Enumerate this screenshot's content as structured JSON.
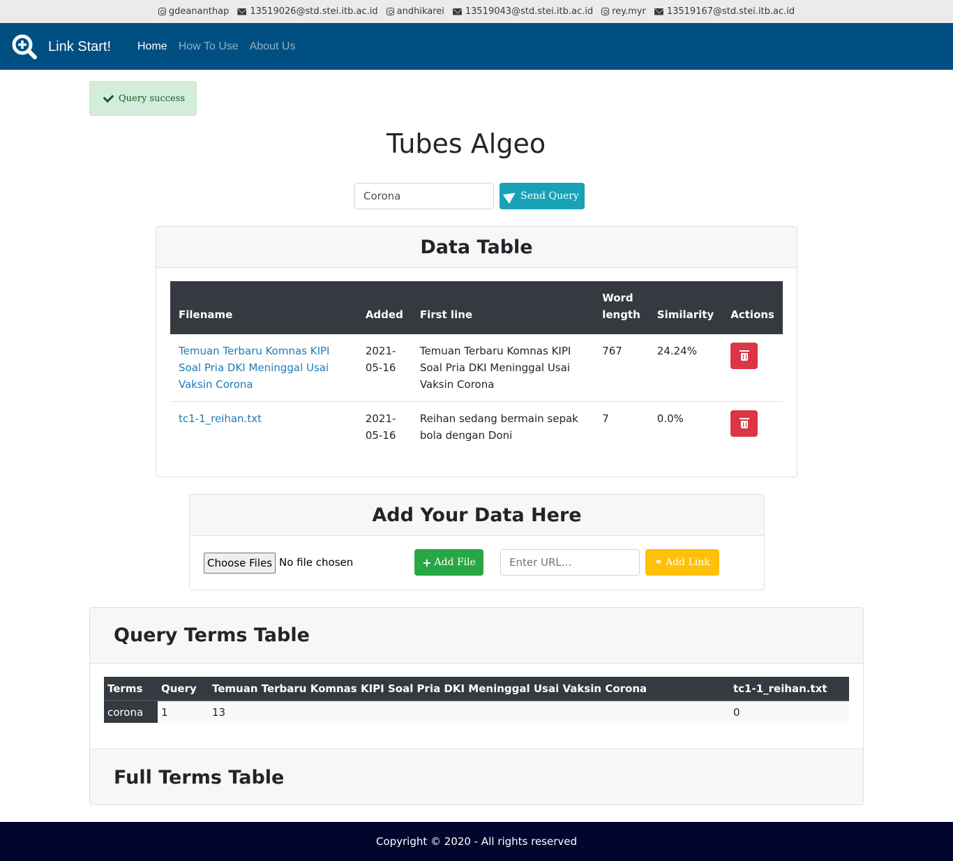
{
  "contacts": [
    {
      "type": "instagram",
      "text": "gdeananthap"
    },
    {
      "type": "email",
      "text": "13519026@std.stei.itb.ac.id"
    },
    {
      "type": "instagram",
      "text": "andhikarei"
    },
    {
      "type": "email",
      "text": "13519043@std.stei.itb.ac.id"
    },
    {
      "type": "instagram",
      "text": "rey.myr"
    },
    {
      "type": "email",
      "text": "13519167@std.stei.itb.ac.id"
    }
  ],
  "navbar": {
    "brand": "Link Start!",
    "links": [
      {
        "label": "Home",
        "active": true
      },
      {
        "label": "How To Use",
        "active": false
      },
      {
        "label": "About Us",
        "active": false
      }
    ]
  },
  "alert": {
    "text": "Query success"
  },
  "title": "Tubes Algeo",
  "search": {
    "value": "Corona",
    "button_label": "Send Query"
  },
  "data_table": {
    "title": "Data Table",
    "columns": [
      "Filename",
      "Added",
      "First line",
      "Word length",
      "Similarity",
      "Actions"
    ],
    "rows": [
      {
        "filename": "Temuan Terbaru Komnas KIPI Soal Pria DKI Meninggal Usai Vaksin Corona",
        "added": "2021-05-16",
        "first_line": "Temuan Terbaru Komnas KIPI Soal Pria DKI Meninggal Usai Vaksin Corona",
        "word_length": "767",
        "similarity": "24.24%"
      },
      {
        "filename": "tc1-1_reihan.txt",
        "added": "2021-05-16",
        "first_line": "Reihan sedang bermain sepak bola dengan Doni",
        "word_length": "7",
        "similarity": "0.0%"
      }
    ]
  },
  "add_data": {
    "title": "Add Your Data Here",
    "choose_files_label": "Choose Files",
    "no_file_text": "No file chosen",
    "add_file_label": "Add File",
    "url_placeholder": "Enter URL...",
    "add_link_label": "Add Link"
  },
  "query_terms": {
    "title": "Query Terms Table",
    "columns": [
      "Terms",
      "Query",
      "Temuan Terbaru Komnas KIPI Soal Pria DKI Meninggal Usai Vaksin Corona",
      "tc1-1_reihan.txt"
    ],
    "rows": [
      {
        "term": "corona",
        "query": "1",
        "doc1": "13",
        "doc2": "0"
      }
    ]
  },
  "full_terms": {
    "title": "Full Terms Table"
  },
  "footer": {
    "text": "Copyright © 2020 - All rights reserved"
  },
  "colors": {
    "navbar": "#004f82",
    "footer": "#02062e",
    "send": "#17a2b8",
    "delete": "#dc3545",
    "add_file": "#28a745",
    "add_link": "#ffc107",
    "link": "#1e7ab8"
  }
}
